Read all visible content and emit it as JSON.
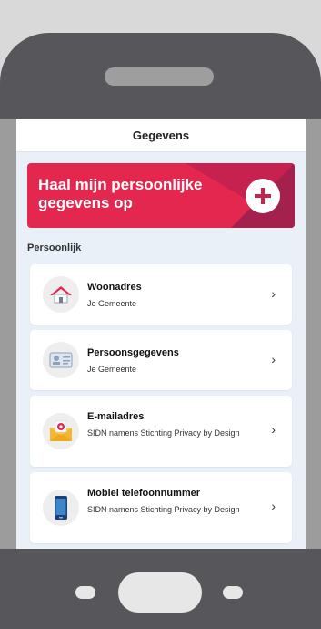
{
  "screen_title": "Gegevens",
  "hero": {
    "text": "Haal mijn persoonlijke gegevens op",
    "plus_icon": "plus-icon"
  },
  "section": "Persoonlijk",
  "items": [
    {
      "title": "Woonadres",
      "subtitle": "Je Gemeente",
      "icon": "house-icon",
      "chevron": "›"
    },
    {
      "title": "Persoonsgegevens",
      "subtitle": "Je Gemeente",
      "icon": "id-card-icon",
      "chevron": "›"
    },
    {
      "title": "E-mailadres",
      "subtitle": "SIDN namens Stichting Privacy by Design",
      "icon": "email-icon",
      "chevron": "›"
    },
    {
      "title": "Mobiel telefoonnummer",
      "subtitle": "SIDN namens Stichting Privacy by Design",
      "icon": "mobile-phone-icon",
      "chevron": "›"
    }
  ],
  "colors": {
    "accent": "#e4274f",
    "screen_bg": "#e9f0f8",
    "phone_body": "#57575b"
  }
}
